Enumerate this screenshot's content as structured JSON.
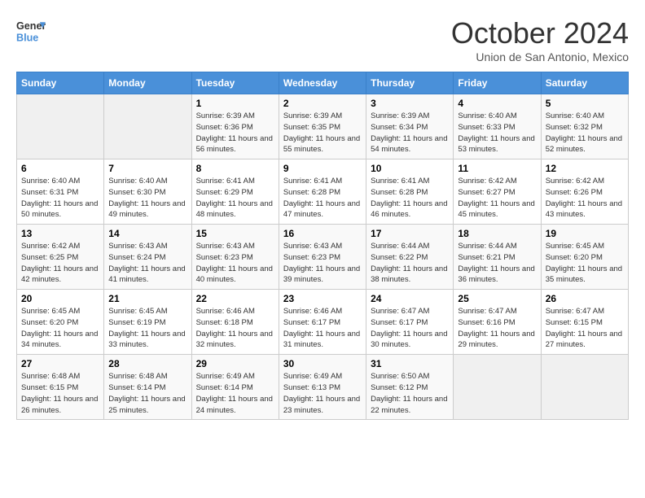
{
  "header": {
    "logo_line1": "General",
    "logo_line2": "Blue",
    "month": "October 2024",
    "location": "Union de San Antonio, Mexico"
  },
  "days_of_week": [
    "Sunday",
    "Monday",
    "Tuesday",
    "Wednesday",
    "Thursday",
    "Friday",
    "Saturday"
  ],
  "weeks": [
    [
      {
        "day": "",
        "info": ""
      },
      {
        "day": "",
        "info": ""
      },
      {
        "day": "1",
        "info": "Sunrise: 6:39 AM\nSunset: 6:36 PM\nDaylight: 11 hours and 56 minutes."
      },
      {
        "day": "2",
        "info": "Sunrise: 6:39 AM\nSunset: 6:35 PM\nDaylight: 11 hours and 55 minutes."
      },
      {
        "day": "3",
        "info": "Sunrise: 6:39 AM\nSunset: 6:34 PM\nDaylight: 11 hours and 54 minutes."
      },
      {
        "day": "4",
        "info": "Sunrise: 6:40 AM\nSunset: 6:33 PM\nDaylight: 11 hours and 53 minutes."
      },
      {
        "day": "5",
        "info": "Sunrise: 6:40 AM\nSunset: 6:32 PM\nDaylight: 11 hours and 52 minutes."
      }
    ],
    [
      {
        "day": "6",
        "info": "Sunrise: 6:40 AM\nSunset: 6:31 PM\nDaylight: 11 hours and 50 minutes."
      },
      {
        "day": "7",
        "info": "Sunrise: 6:40 AM\nSunset: 6:30 PM\nDaylight: 11 hours and 49 minutes."
      },
      {
        "day": "8",
        "info": "Sunrise: 6:41 AM\nSunset: 6:29 PM\nDaylight: 11 hours and 48 minutes."
      },
      {
        "day": "9",
        "info": "Sunrise: 6:41 AM\nSunset: 6:28 PM\nDaylight: 11 hours and 47 minutes."
      },
      {
        "day": "10",
        "info": "Sunrise: 6:41 AM\nSunset: 6:28 PM\nDaylight: 11 hours and 46 minutes."
      },
      {
        "day": "11",
        "info": "Sunrise: 6:42 AM\nSunset: 6:27 PM\nDaylight: 11 hours and 45 minutes."
      },
      {
        "day": "12",
        "info": "Sunrise: 6:42 AM\nSunset: 6:26 PM\nDaylight: 11 hours and 43 minutes."
      }
    ],
    [
      {
        "day": "13",
        "info": "Sunrise: 6:42 AM\nSunset: 6:25 PM\nDaylight: 11 hours and 42 minutes."
      },
      {
        "day": "14",
        "info": "Sunrise: 6:43 AM\nSunset: 6:24 PM\nDaylight: 11 hours and 41 minutes."
      },
      {
        "day": "15",
        "info": "Sunrise: 6:43 AM\nSunset: 6:23 PM\nDaylight: 11 hours and 40 minutes."
      },
      {
        "day": "16",
        "info": "Sunrise: 6:43 AM\nSunset: 6:23 PM\nDaylight: 11 hours and 39 minutes."
      },
      {
        "day": "17",
        "info": "Sunrise: 6:44 AM\nSunset: 6:22 PM\nDaylight: 11 hours and 38 minutes."
      },
      {
        "day": "18",
        "info": "Sunrise: 6:44 AM\nSunset: 6:21 PM\nDaylight: 11 hours and 36 minutes."
      },
      {
        "day": "19",
        "info": "Sunrise: 6:45 AM\nSunset: 6:20 PM\nDaylight: 11 hours and 35 minutes."
      }
    ],
    [
      {
        "day": "20",
        "info": "Sunrise: 6:45 AM\nSunset: 6:20 PM\nDaylight: 11 hours and 34 minutes."
      },
      {
        "day": "21",
        "info": "Sunrise: 6:45 AM\nSunset: 6:19 PM\nDaylight: 11 hours and 33 minutes."
      },
      {
        "day": "22",
        "info": "Sunrise: 6:46 AM\nSunset: 6:18 PM\nDaylight: 11 hours and 32 minutes."
      },
      {
        "day": "23",
        "info": "Sunrise: 6:46 AM\nSunset: 6:17 PM\nDaylight: 11 hours and 31 minutes."
      },
      {
        "day": "24",
        "info": "Sunrise: 6:47 AM\nSunset: 6:17 PM\nDaylight: 11 hours and 30 minutes."
      },
      {
        "day": "25",
        "info": "Sunrise: 6:47 AM\nSunset: 6:16 PM\nDaylight: 11 hours and 29 minutes."
      },
      {
        "day": "26",
        "info": "Sunrise: 6:47 AM\nSunset: 6:15 PM\nDaylight: 11 hours and 27 minutes."
      }
    ],
    [
      {
        "day": "27",
        "info": "Sunrise: 6:48 AM\nSunset: 6:15 PM\nDaylight: 11 hours and 26 minutes."
      },
      {
        "day": "28",
        "info": "Sunrise: 6:48 AM\nSunset: 6:14 PM\nDaylight: 11 hours and 25 minutes."
      },
      {
        "day": "29",
        "info": "Sunrise: 6:49 AM\nSunset: 6:14 PM\nDaylight: 11 hours and 24 minutes."
      },
      {
        "day": "30",
        "info": "Sunrise: 6:49 AM\nSunset: 6:13 PM\nDaylight: 11 hours and 23 minutes."
      },
      {
        "day": "31",
        "info": "Sunrise: 6:50 AM\nSunset: 6:12 PM\nDaylight: 11 hours and 22 minutes."
      },
      {
        "day": "",
        "info": ""
      },
      {
        "day": "",
        "info": ""
      }
    ]
  ]
}
